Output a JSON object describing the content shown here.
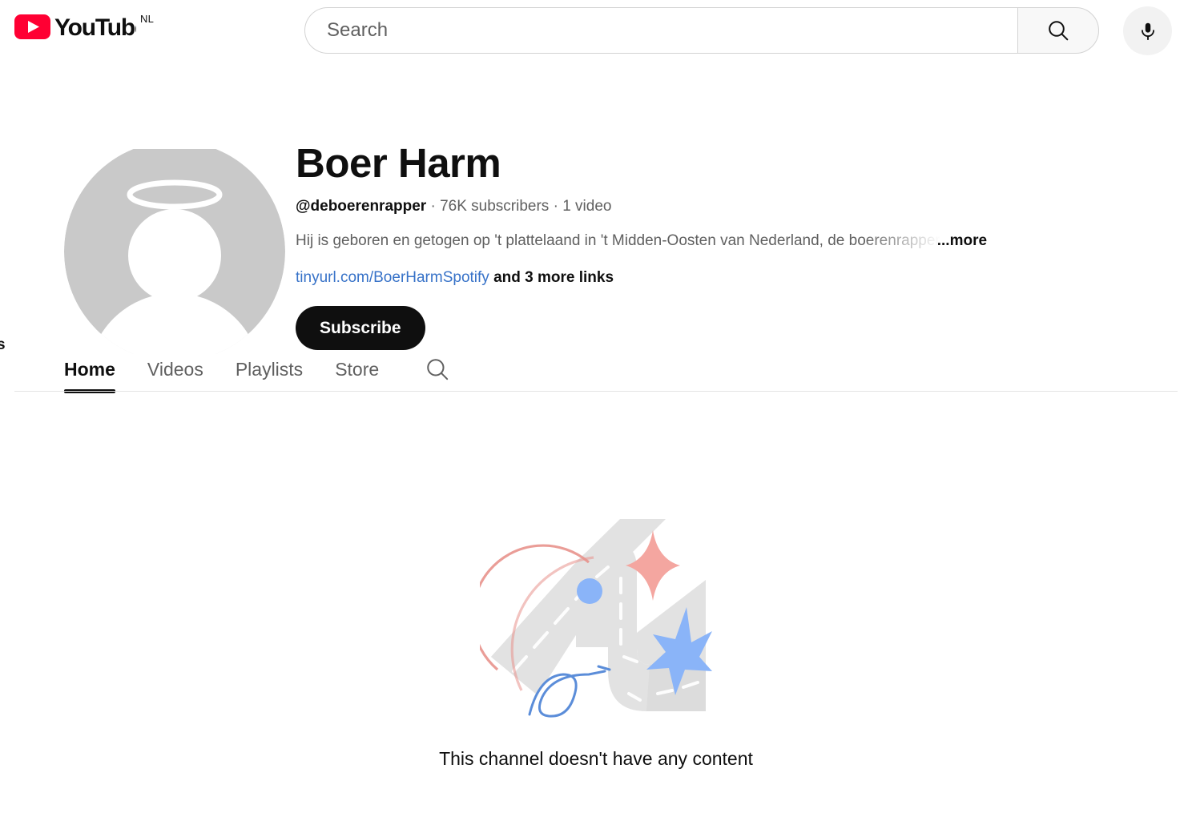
{
  "masthead": {
    "logo_name": "YouTube",
    "country_code": "NL",
    "search": {
      "placeholder": "Search",
      "value": "",
      "button_icon": "search-icon"
    },
    "voice_search_icon": "microphone-icon"
  },
  "channel": {
    "avatar_icon": "default-avatar-placeholder",
    "name": "Boer Harm",
    "handle": "@deboerenrapper",
    "separator": "·",
    "subscribers": "76K subscribers",
    "video_count": "1 video",
    "description": "Hij is geboren en getogen op 't plattelaand in 't Midden-Oosten van Nederland, de boerenrapper",
    "more_label": "...more",
    "primary_link": "tinyurl.com/BoerHarmSpotify",
    "links_more_label": "and 3 more links",
    "subscribe_label": "Subscribe"
  },
  "tabs": {
    "clipped_left_text": "s",
    "items": [
      {
        "label": "Home",
        "active": true
      },
      {
        "label": "Videos",
        "active": false
      },
      {
        "label": "Playlists",
        "active": false
      },
      {
        "label": "Store",
        "active": false
      }
    ],
    "search_icon": "search-icon"
  },
  "empty_state": {
    "illustration_name": "winding-road-illustration",
    "message": "This channel doesn't have any content"
  },
  "colors": {
    "brand_red": "#ff0033",
    "text_primary": "#0f0f0f",
    "text_secondary": "#606060",
    "link_blue": "#3772c8",
    "illustration_road": "#e0e0e0",
    "illustration_pink": "#f4a6a0",
    "illustration_blue": "#8ab4f8",
    "illustration_red_arc": "#e8928c",
    "divider": "#e5e5e5"
  }
}
